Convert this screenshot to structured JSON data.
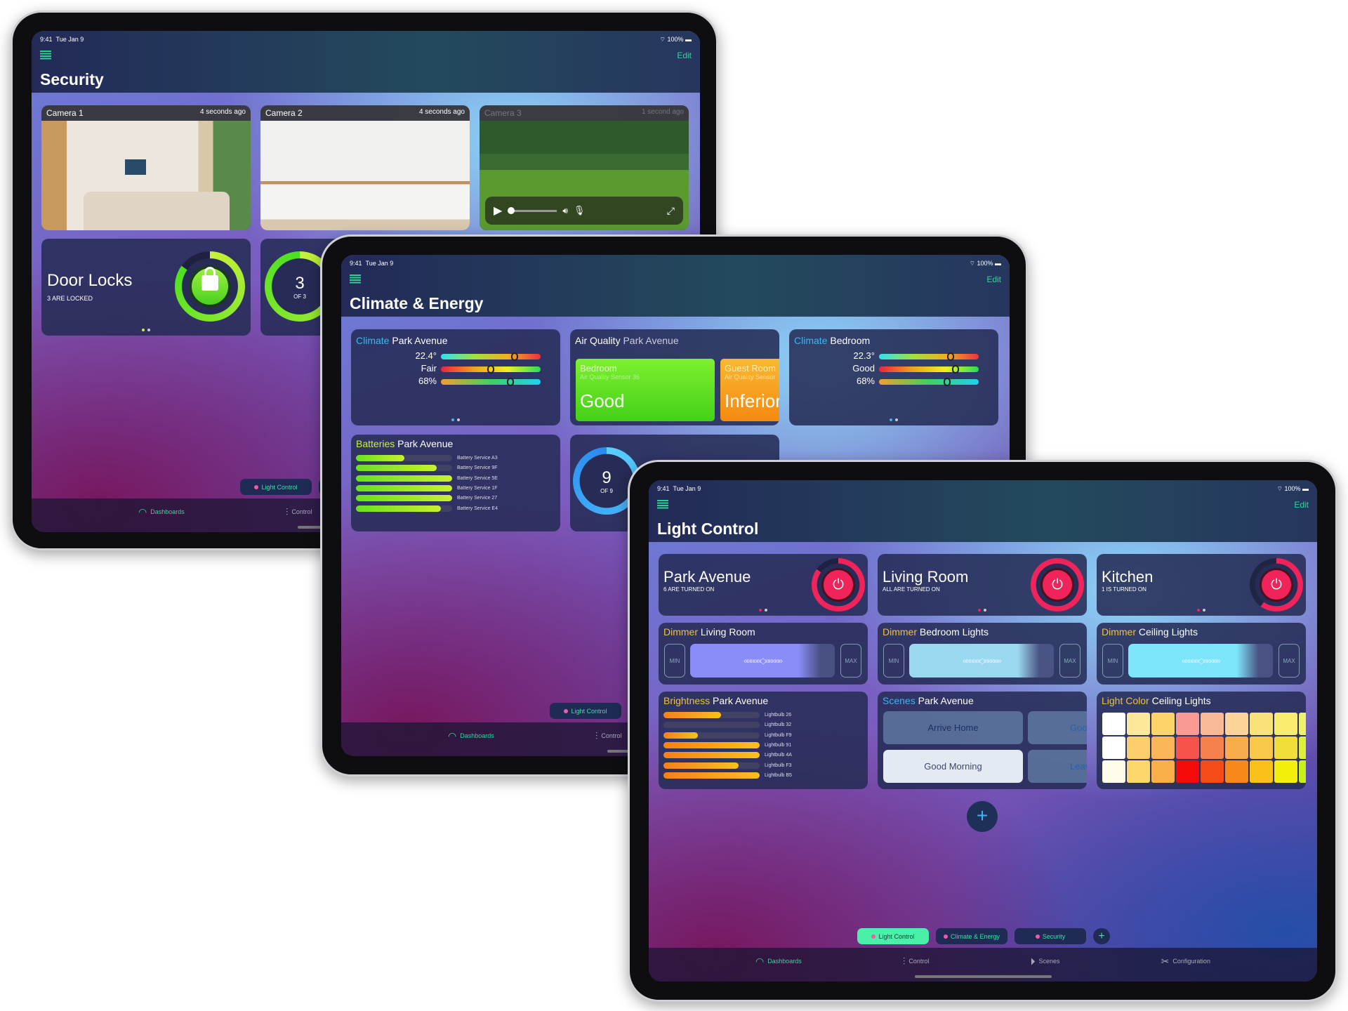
{
  "status_bar": {
    "time": "9:41",
    "date": "Tue Jan 9",
    "battery": "100%"
  },
  "common": {
    "edit_label": "Edit",
    "pills": [
      {
        "label": "Light Control"
      },
      {
        "label": "Climate & Energy"
      },
      {
        "label": "Security"
      }
    ],
    "add_pill": "+",
    "tabs": [
      {
        "label": "Dashboards",
        "icon": "gauge-icon"
      },
      {
        "label": "Control",
        "icon": "sliders-icon"
      },
      {
        "label": "Scenes",
        "icon": "play-circle-icon"
      },
      {
        "label": "Configuration",
        "icon": "wrench-icon"
      }
    ]
  },
  "security": {
    "title": "Security",
    "cameras": [
      {
        "name": "Camera 1",
        "time": "4 seconds ago"
      },
      {
        "name": "Camera 2",
        "time": "4 seconds ago"
      },
      {
        "name": "Camera 3",
        "time": "1 second ago"
      }
    ],
    "door_locks": {
      "title": "Door Locks",
      "subtitle": "3 ARE LOCKED",
      "fraction": 0.85
    },
    "lock_count": {
      "value": "3",
      "of": "OF 3",
      "fraction": 1.0
    },
    "accent": "#8df03a"
  },
  "climate": {
    "title": "Climate & Energy",
    "climate_park": {
      "type": "Climate",
      "room": "Park Avenue",
      "rows": [
        {
          "label": "22.4°",
          "pos": 0.74
        },
        {
          "label": "Fair",
          "pos": 0.5
        },
        {
          "label": "68%",
          "pos": 0.7
        }
      ]
    },
    "air_quality": {
      "type": "Air Quality",
      "room": "Park Avenue",
      "tiles": [
        {
          "room": "Bedroom",
          "sensor": "Air Quality Sensor 36",
          "status": "Good",
          "color": "#5ee020"
        },
        {
          "room": "Guest Room",
          "sensor": "Air Quality Sensor",
          "status": "Inferior",
          "color": "#f7a020"
        }
      ]
    },
    "climate_bedroom": {
      "type": "Climate",
      "room": "Bedroom",
      "rows": [
        {
          "label": "22.3°",
          "pos": 0.72
        },
        {
          "label": "Good",
          "pos": 0.77
        },
        {
          "label": "68%",
          "pos": 0.68
        }
      ]
    },
    "batteries": {
      "type": "Batteries",
      "room": "Park Avenue",
      "items": [
        {
          "label": "Battery Service A3",
          "level": 0.5
        },
        {
          "label": "Battery Service 9F",
          "level": 0.84
        },
        {
          "label": "Battery Service 5E",
          "level": 1.0
        },
        {
          "label": "Battery Service 1F",
          "level": 1.0
        },
        {
          "label": "Battery Service 27",
          "level": 1.0
        },
        {
          "label": "Battery Service E4",
          "level": 0.88
        }
      ]
    },
    "count": {
      "value": "9",
      "of": "OF 9",
      "fraction": 1.0
    }
  },
  "light": {
    "title": "Light Control",
    "power": [
      {
        "name": "Park Avenue",
        "subtitle": "6 ARE TURNED ON",
        "fraction": 0.85
      },
      {
        "name": "Living Room",
        "subtitle": "ALL ARE TURNED ON",
        "fraction": 1.0
      },
      {
        "name": "Kitchen",
        "subtitle": "1 IS TURNED ON",
        "fraction": 0.6
      }
    ],
    "dimmers": [
      {
        "type": "Dimmer",
        "room": "Living Room",
        "color": "#8a8cf8"
      },
      {
        "type": "Dimmer",
        "room": "Bedroom Lights",
        "color": "#9ad8f0"
      },
      {
        "type": "Dimmer",
        "room": "Ceiling Lights",
        "color": "#7de4fa"
      }
    ],
    "min_label": "MIN",
    "max_label": "MAX",
    "slider_glyph": "«««««◇»»»»»",
    "brightness": {
      "type": "Brightness",
      "room": "Park Avenue",
      "items": [
        {
          "label": "Lightbulb 26",
          "level": 0.6
        },
        {
          "label": "Lightbulb 32",
          "level": 0
        },
        {
          "label": "Lightbulb F9",
          "level": 0.36
        },
        {
          "label": "Lightbulb 91",
          "level": 1.0
        },
        {
          "label": "Lightbulb 4A",
          "level": 1.0
        },
        {
          "label": "Lightbulb F3",
          "level": 0.78
        },
        {
          "label": "Lightbulb B5",
          "level": 1.0
        }
      ]
    },
    "scenes": {
      "type": "Scenes",
      "room": "Park Avenue",
      "items": [
        "Arrive Home",
        "Goo",
        "Good Morning",
        "Leav"
      ]
    },
    "light_color": {
      "type": "Light Color",
      "room": "Ceiling Lights",
      "colors": [
        [
          "#ffffff",
          "#fde79a",
          "#fcd46a",
          "#f99a94",
          "#f9b896",
          "#fcd49a",
          "#f9e27a",
          "#f7ec6e",
          "#eef26a"
        ],
        [
          "#ffffff",
          "#fccf6c",
          "#fbb65a",
          "#f5534c",
          "#f5814c",
          "#f9ac4c",
          "#f9c84a",
          "#f2de3a",
          "#dcef3a"
        ],
        [
          "#fffbe9",
          "#fcd86a",
          "#f9b04a",
          "#f50a0a",
          "#f54a1a",
          "#f8881a",
          "#f9c01a",
          "#f2f00a",
          "#c8f01a"
        ]
      ]
    },
    "add_button": "+"
  },
  "colors": {
    "accent_green": "#35d49a",
    "power_red": "#f0245a",
    "climate_blue": "#3ab8f0",
    "label_yellow": "#f0c040",
    "battery_green": "#8df03a"
  }
}
